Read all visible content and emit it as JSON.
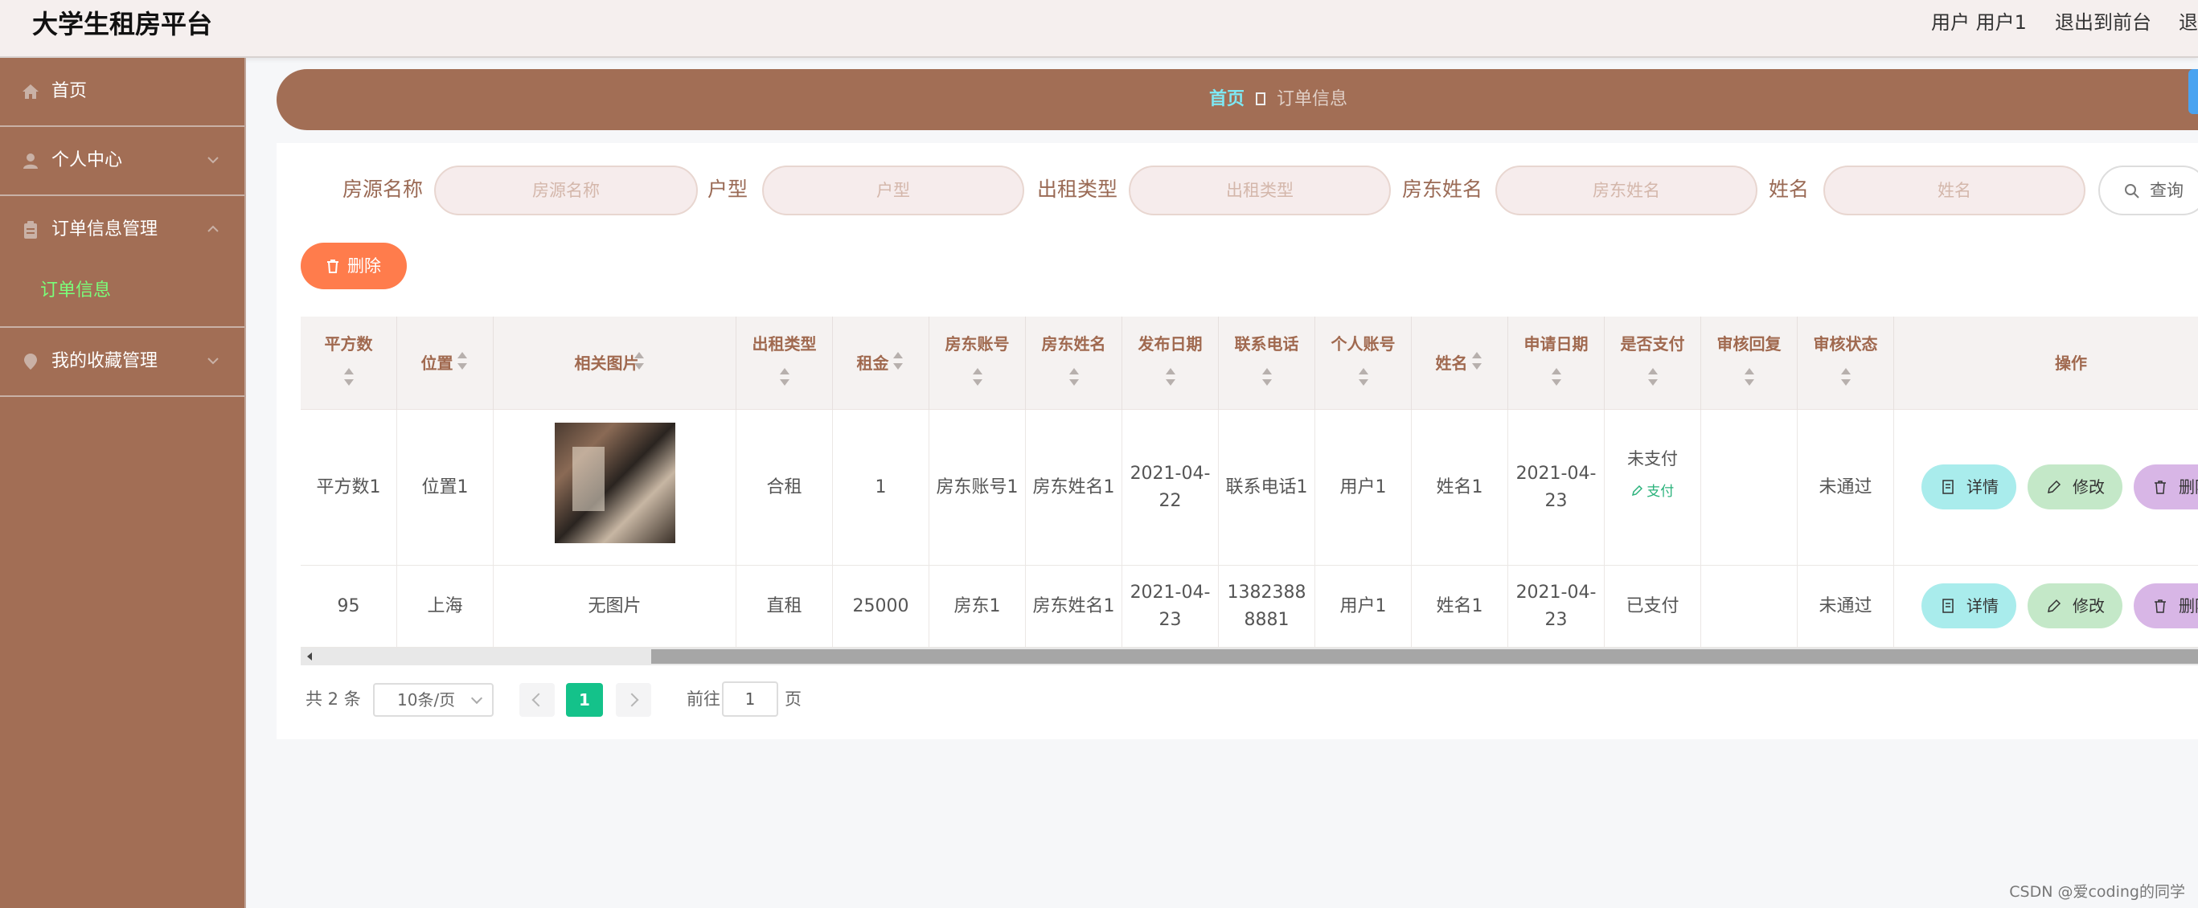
{
  "header": {
    "brand": "大学生租房平台",
    "user_label": "用户 用户1",
    "exit_front": "退出到前台",
    "exit": "退"
  },
  "sidebar": {
    "items": [
      {
        "label": "首页",
        "icon": "home-icon"
      },
      {
        "label": "个人中心",
        "icon": "user-icon"
      },
      {
        "label": "订单信息管理",
        "icon": "clipboard-icon",
        "sub": [
          "订单信息"
        ]
      },
      {
        "label": "我的收藏管理",
        "icon": "pin-icon"
      }
    ]
  },
  "breadcrumb": {
    "home": "首页",
    "current": "订单信息"
  },
  "search": {
    "fields": [
      {
        "label": "房源名称",
        "placeholder": "房源名称"
      },
      {
        "label": "户型",
        "placeholder": "户型"
      },
      {
        "label": "出租类型",
        "placeholder": "出租类型"
      },
      {
        "label": "房东姓名",
        "placeholder": "房东姓名"
      },
      {
        "label": "姓名",
        "placeholder": "姓名"
      }
    ],
    "button": "查询"
  },
  "toolbar": {
    "delete_label": "删除"
  },
  "table": {
    "columns": [
      "平方数",
      "位置",
      "相关图片",
      "出租类型",
      "租金",
      "房东账号",
      "房东姓名",
      "发布日期",
      "联系电话",
      "个人账号",
      "姓名",
      "申请日期",
      "是否支付",
      "审核回复",
      "审核状态",
      "操作"
    ],
    "rows": [
      {
        "area": "平方数1",
        "location": "位置1",
        "image": "",
        "rent_type": "合租",
        "rent": "1",
        "landlord_account": "房东账号1",
        "landlord_name": "房东姓名1",
        "publish_date": "2021-04-22",
        "phone": "联系电话1",
        "user_account": "用户1",
        "name": "姓名1",
        "apply_date": "2021-04-23",
        "paid": "未支付",
        "pay_action": "支付",
        "review_reply": "",
        "review_status": "未通过"
      },
      {
        "area": "95",
        "location": "上海",
        "image": "无图片",
        "rent_type": "直租",
        "rent": "25000",
        "landlord_account": "房东1",
        "landlord_name": "房东姓名1",
        "publish_date": "2021-04-23",
        "phone": "13823888881",
        "user_account": "用户1",
        "name": "姓名1",
        "apply_date": "2021-04-23",
        "paid": "已支付",
        "pay_action": "",
        "review_reply": "",
        "review_status": "未通过"
      }
    ],
    "actions": {
      "detail": "详情",
      "edit": "修改",
      "delete": "删除"
    }
  },
  "pagination": {
    "total": "共 2 条",
    "page_size": "10条/页",
    "current": "1",
    "goto_label": "前往",
    "goto_value": "1",
    "page_suffix": "页"
  },
  "watermark": "CSDN @爱coding的同学"
}
